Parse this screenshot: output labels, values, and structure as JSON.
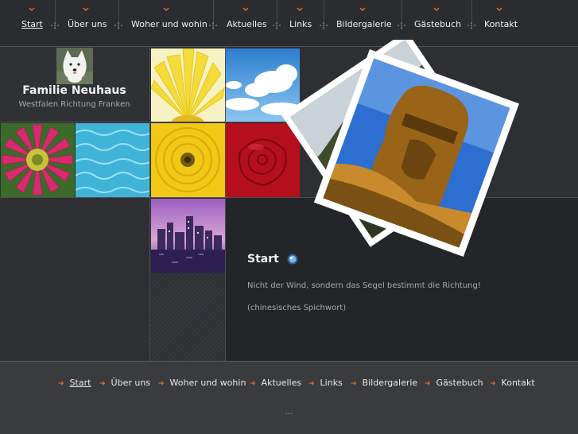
{
  "top_nav": [
    {
      "label": "Start",
      "active": true
    },
    {
      "label": "Über uns"
    },
    {
      "label": "Woher und wohin"
    },
    {
      "label": "Aktuelles"
    },
    {
      "label": "Links"
    },
    {
      "label": "Bildergalerie"
    },
    {
      "label": "Gästebuch"
    },
    {
      "label": "Kontakt"
    }
  ],
  "brand": {
    "title": "Familie Neuhaus",
    "subtitle": "Westfalen Richtung Franken",
    "avatar_icon": "dog-photo"
  },
  "tiles": [
    "yellow-flower-photo",
    "sky-clouds-photo",
    "pink-gerbera-photo",
    "pool-water-photo",
    "yellow-dahlia-photo",
    "red-rose-photo",
    "city-skyline-photo"
  ],
  "photos": [
    "waterfall-landscape-photo",
    "moai-statue-photo"
  ],
  "content": {
    "title": "Start",
    "quote": "Nicht der Wind, sondern das Segel bestimmt die Richtung!",
    "source": "(chinesisches Spichwort)"
  },
  "footer_nav": [
    {
      "label": "Start",
      "active": true
    },
    {
      "label": "Über uns"
    },
    {
      "label": "Woher und wohin"
    },
    {
      "label": "Aktuelles"
    },
    {
      "label": "Links"
    },
    {
      "label": "Bildergalerie"
    },
    {
      "label": "Gästebuch"
    },
    {
      "label": "Kontakt"
    }
  ],
  "footer_note": "...",
  "colors": {
    "accent": "#e4672a",
    "background": "#2e2f33",
    "content_bg": "#242529",
    "footer_bg": "#3a3b3f"
  }
}
